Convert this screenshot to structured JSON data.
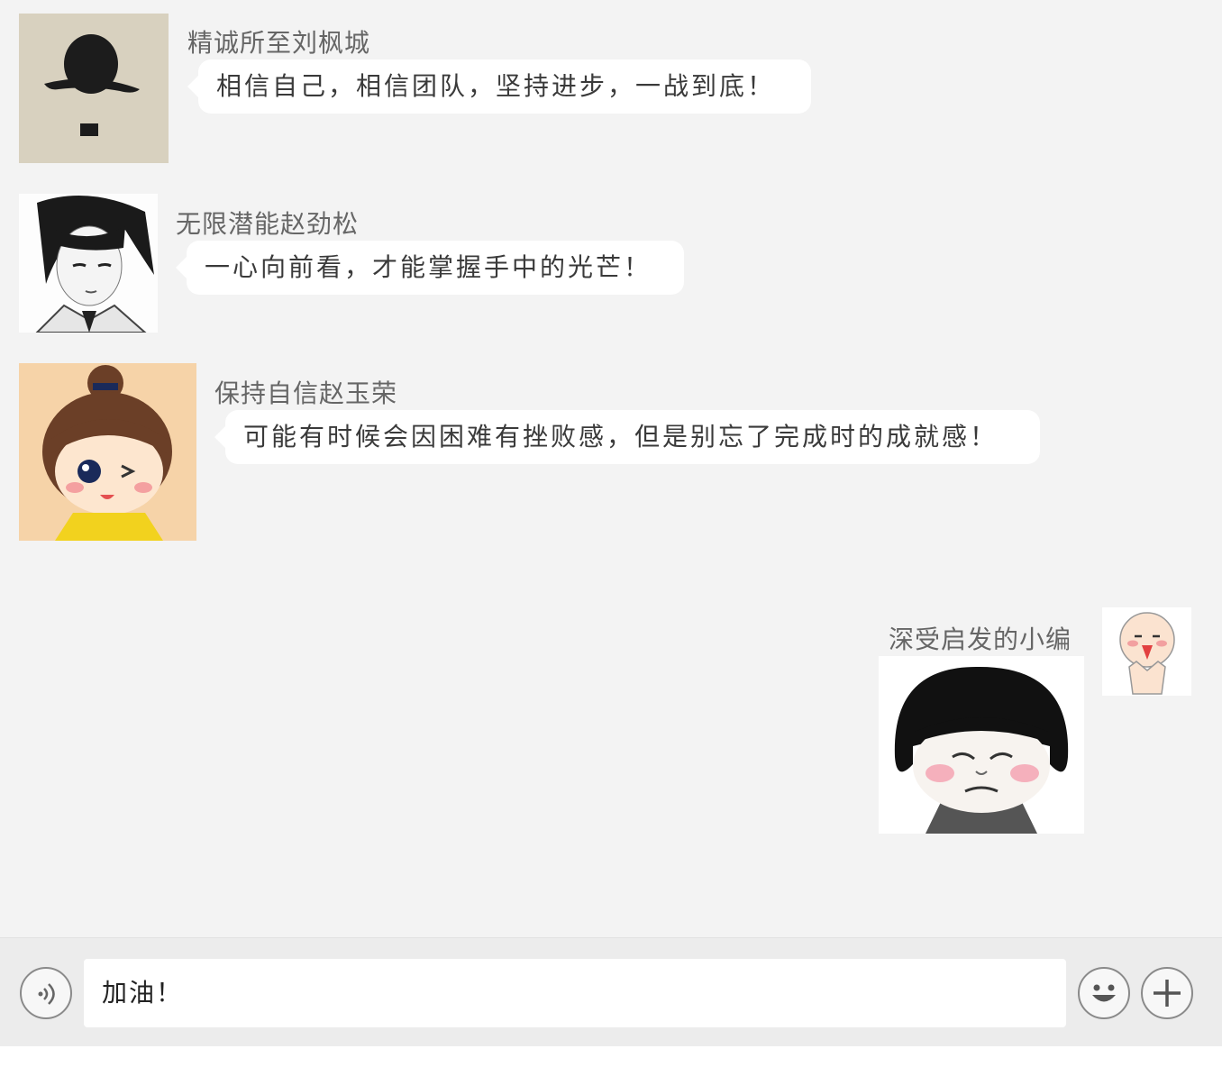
{
  "messages": [
    {
      "sender": "精诚所至刘枫城",
      "text": "相信自己，相信团队，坚持进步，一战到底！",
      "avatar_icon": "bowler-hat-icon"
    },
    {
      "sender": "无限潜能赵劲松",
      "text": "一心向前看，才能掌握手中的光芒！",
      "avatar_icon": "sketch-boy-icon"
    },
    {
      "sender": "保持自信赵玉荣",
      "text": "可能有时候会因困难有挫败感，但是别忘了完成时的成就感！",
      "avatar_icon": "cartoon-girl-icon"
    }
  ],
  "self_message": {
    "sender": "深受启发的小编",
    "sticker_icon": "mushroom-head-sticker-icon",
    "avatar_icon": "bald-kid-icon"
  },
  "input": {
    "value": "加油！",
    "voice_icon": "voice-icon",
    "emoji_icon": "smile-icon",
    "more_icon": "plus-icon"
  },
  "colors": {
    "chat_bg": "#f3f3f3",
    "bubble_bg": "#ffffff",
    "input_bar_bg": "#ececec"
  }
}
